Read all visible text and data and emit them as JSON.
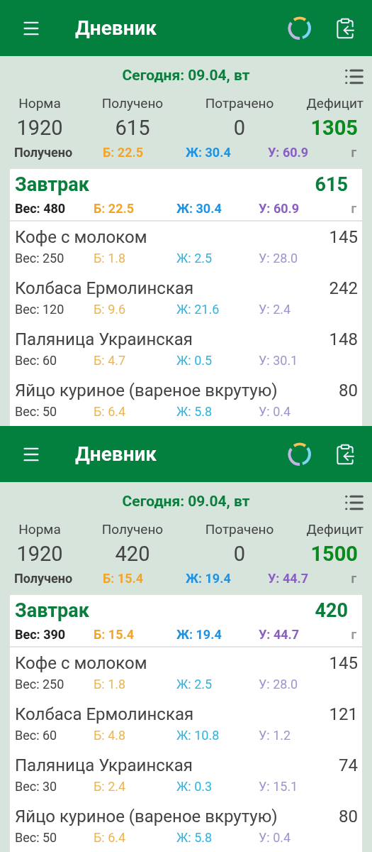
{
  "screens": [
    {
      "app_bar": {
        "title": "Дневник"
      },
      "date": "Сегодня: 09.04, вт",
      "totals": [
        {
          "label": "Норма",
          "value": "1920",
          "kind": "plain"
        },
        {
          "label": "Получено",
          "value": "615",
          "kind": "plain"
        },
        {
          "label": "Потрачено",
          "value": "0",
          "kind": "plain"
        },
        {
          "label": "Дефицит",
          "value": "1305",
          "kind": "highlight"
        }
      ],
      "macros": {
        "label": "Получено",
        "protein": "Б: 22.5",
        "fat": "Ж: 30.4",
        "carbs": "У: 60.9",
        "unit": "г"
      },
      "meal": {
        "title": "Завтрак",
        "kcal": "615",
        "weight": "Вес: 480",
        "protein": "Б: 22.5",
        "fat": "Ж: 30.4",
        "carbs": "У: 60.9",
        "unit": "г",
        "items": [
          {
            "name": "Кофе с молоком",
            "kcal": "145",
            "weight": "Вес: 250",
            "protein": "Б: 1.8",
            "fat": "Ж: 2.5",
            "carbs": "У: 28.0"
          },
          {
            "name": "Колбаса Ермолинская",
            "kcal": "242",
            "weight": "Вес: 120",
            "protein": "Б: 9.6",
            "fat": "Ж: 21.6",
            "carbs": "У: 2.4"
          },
          {
            "name": "Паляница Украинская",
            "kcal": "148",
            "weight": "Вес: 60",
            "protein": "Б: 4.7",
            "fat": "Ж: 0.5",
            "carbs": "У: 30.1"
          },
          {
            "name": "Яйцо куриное (вареное вкрутую)",
            "kcal": "80",
            "weight": "Вес: 50",
            "protein": "Б: 6.4",
            "fat": "Ж: 5.8",
            "carbs": "У: 0.4"
          }
        ]
      }
    },
    {
      "app_bar": {
        "title": "Дневник"
      },
      "date": "Сегодня: 09.04, вт",
      "totals": [
        {
          "label": "Норма",
          "value": "1920",
          "kind": "plain"
        },
        {
          "label": "Получено",
          "value": "420",
          "kind": "plain"
        },
        {
          "label": "Потрачено",
          "value": "0",
          "kind": "plain"
        },
        {
          "label": "Дефицит",
          "value": "1500",
          "kind": "highlight"
        }
      ],
      "macros": {
        "label": "Получено",
        "protein": "Б: 15.4",
        "fat": "Ж: 19.4",
        "carbs": "У: 44.7",
        "unit": "г"
      },
      "meal": {
        "title": "Завтрак",
        "kcal": "420",
        "weight": "Вес: 390",
        "protein": "Б: 15.4",
        "fat": "Ж: 19.4",
        "carbs": "У: 44.7",
        "unit": "г",
        "items": [
          {
            "name": "Кофе с молоком",
            "kcal": "145",
            "weight": "Вес: 250",
            "protein": "Б: 1.8",
            "fat": "Ж: 2.5",
            "carbs": "У: 28.0"
          },
          {
            "name": "Колбаса Ермолинская",
            "kcal": "121",
            "weight": "Вес: 60",
            "protein": "Б: 4.8",
            "fat": "Ж: 10.8",
            "carbs": "У: 1.2"
          },
          {
            "name": "Паляница Украинская",
            "kcal": "74",
            "weight": "Вес: 30",
            "protein": "Б: 2.4",
            "fat": "Ж: 0.3",
            "carbs": "У: 15.1"
          },
          {
            "name": "Яйцо куриное (вареное вкрутую)",
            "kcal": "80",
            "weight": "Вес: 50",
            "protein": "Б: 6.4",
            "fat": "Ж: 5.8",
            "carbs": "У: 0.4"
          }
        ]
      }
    }
  ]
}
